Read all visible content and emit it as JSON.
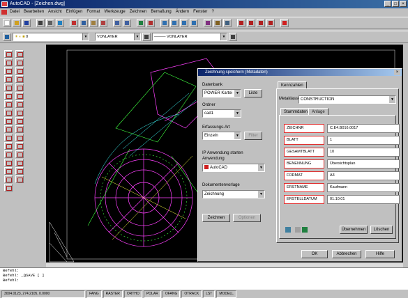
{
  "app": {
    "title": "AutoCAD - [Zeichen.dwg]",
    "window_buttons": [
      "_",
      "□",
      "×"
    ]
  },
  "menu": [
    "Datei",
    "Bearbeiten",
    "Ansicht",
    "Einfügen",
    "Format",
    "Werkzeuge",
    "Zeichnen",
    "Bemaßung",
    "Ändern",
    "Fenster",
    "?"
  ],
  "layer_bar": {
    "layer": "0",
    "color": "VONLAYER",
    "linetype": "VONLAYER"
  },
  "dialog": {
    "title": "Zeichnung speichern (Metadaten)",
    "close": "×",
    "left": {
      "standard_label": "Datenbank",
      "standard_value": "POWER Kartei",
      "liste_btn": "Liste",
      "ordner_label": "Ordner",
      "ordner_value": "cad1",
      "erfassung_label": "Erfassungs-Art",
      "erfassung_value": "Einzeln",
      "filter_btn": "Filter",
      "ip_label": "IP Anwendung starten",
      "anwendung_label": "Anwendung",
      "anwendung_value": "AutoCAD",
      "vorlage_label": "Dokumentenvorlage",
      "vorlage_value": "Zeichnung",
      "zeichnen_btn": "Zeichnen",
      "optionen_btn": "Optionen"
    },
    "right": {
      "tab_top": "Kennzahlen",
      "metaklasse_label": "Metaklasse",
      "metaklasse_value": "CONSTRUCTION",
      "tabs": [
        "Stammdaten",
        "Anlage"
      ],
      "attributes": [
        {
          "key": "ZEICHNR",
          "value": "C.E4.B016.0017"
        },
        {
          "key": "BLATT",
          "value": "1"
        },
        {
          "key": "GESAMTBLATT",
          "value": "10"
        },
        {
          "key": "BENENNUNG",
          "value": "Übersichtsplan"
        },
        {
          "key": "FORMAT",
          "value": "A3"
        },
        {
          "key": "ERSTNAME",
          "value": "Kaufmann"
        },
        {
          "key": "ERSTELLDATUM",
          "value": "01.10.01"
        }
      ],
      "uebernehmen_btn": "Übernehmen",
      "loeschen_btn": "Löschen"
    },
    "footer": {
      "ok_btn": "OK",
      "abbrechen_btn": "Abbrechen",
      "hilfe_btn": "Hilfe"
    }
  },
  "command_lines": [
    "Befehl:",
    "Befehl:   _QSAVE [ ]",
    "Befehl:"
  ],
  "status": [
    "3004.0123, 274.2105, 0.0000",
    "FANG",
    "RASTER",
    "ORTHO",
    "POLAR",
    "OFANG",
    "OTRACK",
    "LST",
    "MODELL"
  ]
}
